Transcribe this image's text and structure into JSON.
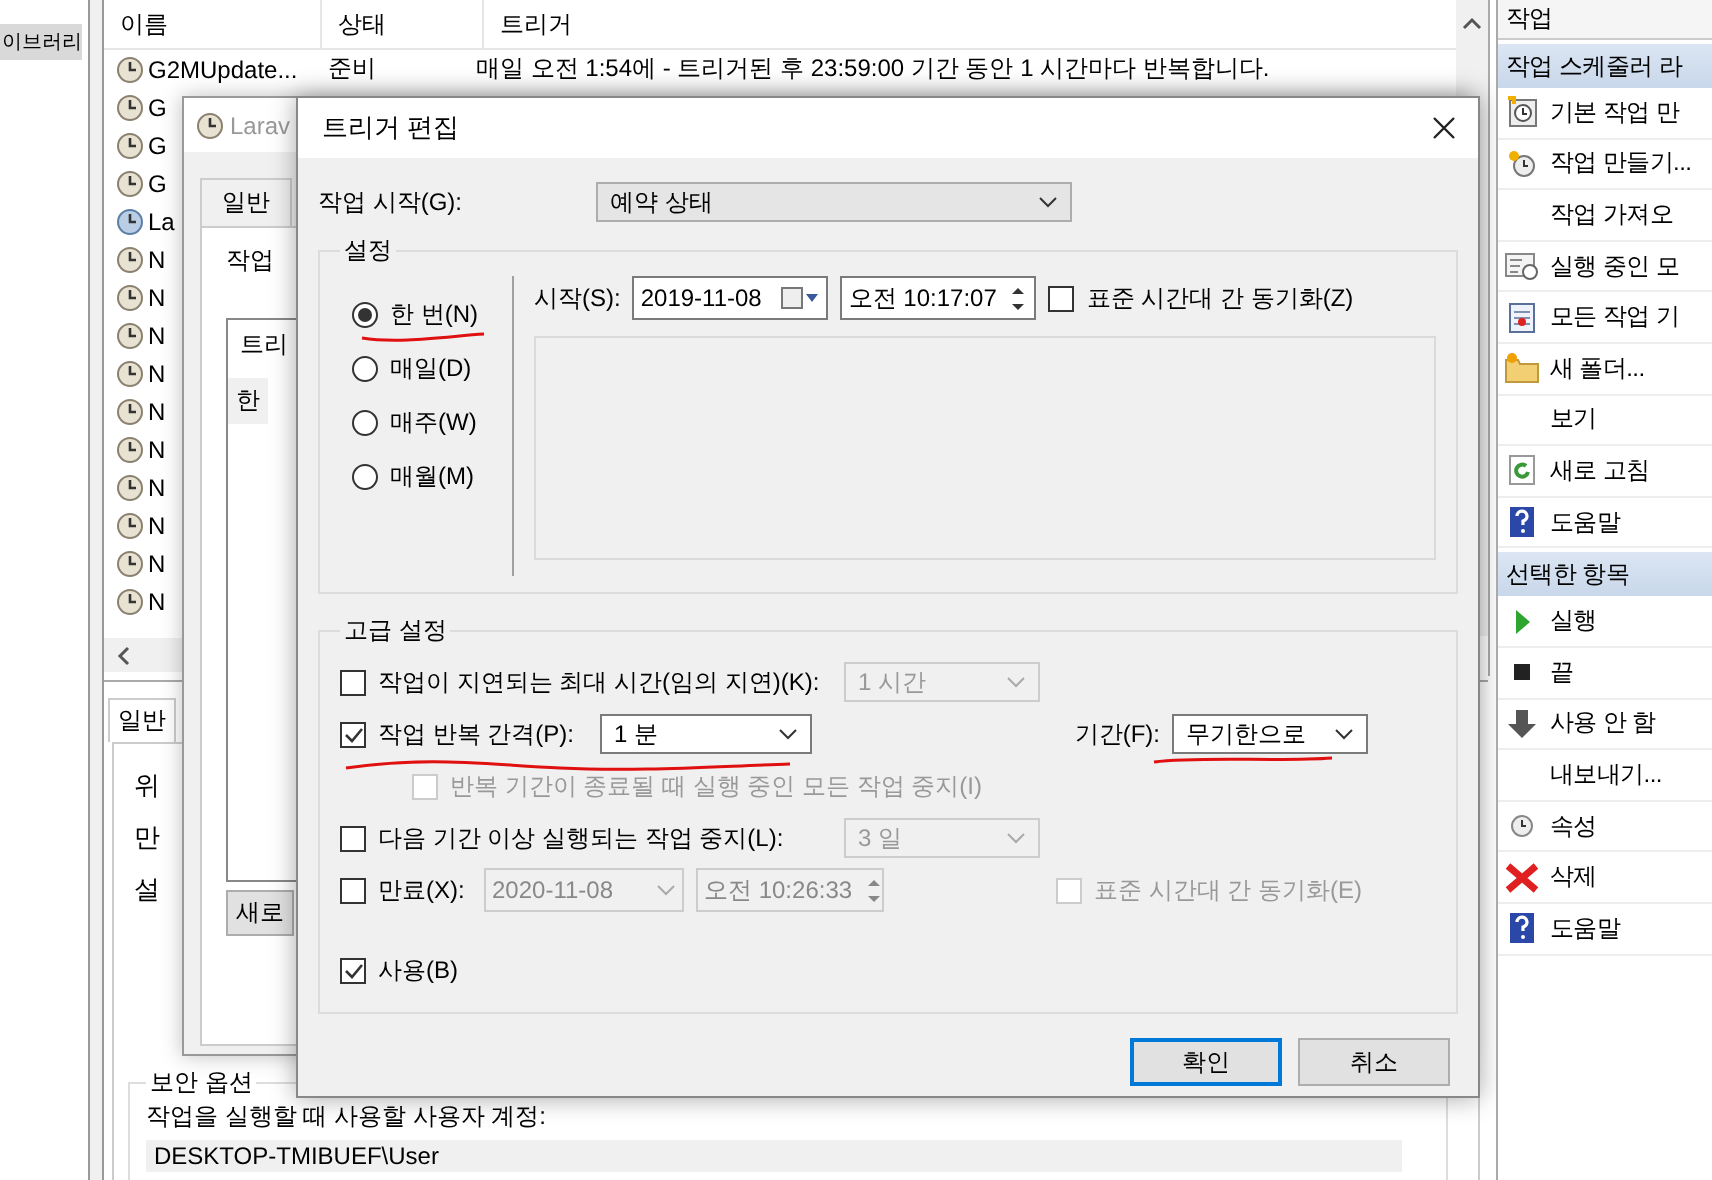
{
  "navigation": {
    "items": [
      {
        "label": "이브러리",
        "selected": true
      }
    ]
  },
  "task_list": {
    "columns": [
      "이름",
      "상태",
      "트리거"
    ],
    "rows": [
      {
        "name": "G2MUpdate...",
        "status": "준비",
        "trigger": "매일 오전 1:54에 - 트리거된 후 23:59:00 기간 동안 1 시간마다 반복합니다.",
        "selected": false
      },
      {
        "name": "G",
        "selected": false
      },
      {
        "name": "G",
        "selected": false
      },
      {
        "name": "G",
        "selected": false
      },
      {
        "name": "La",
        "selected": true
      },
      {
        "name": "N",
        "selected": false
      },
      {
        "name": "N",
        "selected": false
      },
      {
        "name": "N",
        "selected": false
      },
      {
        "name": "N",
        "selected": false
      },
      {
        "name": "N",
        "selected": false
      },
      {
        "name": "N",
        "selected": false
      },
      {
        "name": "N",
        "selected": false
      },
      {
        "name": "N",
        "selected": false
      },
      {
        "name": "N",
        "selected": false
      },
      {
        "name": "N",
        "selected": false
      }
    ]
  },
  "general_panel": {
    "tab": "일반",
    "labels": [
      "위",
      "만",
      "설"
    ],
    "security_group": "보안 옵션",
    "account_label": "작업을 실행할 때 사용할 사용자 계정:",
    "account": "DESKTOP-TMIBUEF\\User"
  },
  "task_window": {
    "title": "Larav",
    "tab": "일반",
    "prompt": "작업",
    "trigger_list": {
      "column": "트리",
      "rows": [
        "한"
      ]
    },
    "new_button": "새로"
  },
  "trigger_dialog": {
    "title": "트리거 편집",
    "begin_label": "작업 시작(G):",
    "begin_value": "예약 상태",
    "settings_group": "설정",
    "schedules": [
      {
        "label": "한 번(N)",
        "selected": true
      },
      {
        "label": "매일(D)",
        "selected": false
      },
      {
        "label": "매주(W)",
        "selected": false
      },
      {
        "label": "매월(M)",
        "selected": false
      }
    ],
    "start_label": "시작(S):",
    "start_date": "2019-11-08",
    "start_time": "오전 10:17:07",
    "sync_timezone": {
      "label": "표준 시간대 간 동기화(Z)",
      "checked": false
    },
    "advanced_group": "고급 설정",
    "delay": {
      "label": "작업이 지연되는 최대 시간(임의 지연)(K):",
      "checked": false,
      "value": "1 시간"
    },
    "repeat": {
      "label": "작업 반복 간격(P):",
      "checked": true,
      "value": "1 분",
      "duration_label": "기간(F):",
      "duration_value": "무기한으로"
    },
    "stop_at_end": {
      "label": "반복 기간이 종료될 때 실행 중인 모든 작업 중지(I)",
      "checked": false,
      "disabled": true
    },
    "stop_longer": {
      "label": "다음 기간 이상 실행되는 작업 중지(L):",
      "checked": false,
      "value": "3 일"
    },
    "expire": {
      "label": "만료(X):",
      "checked": false,
      "date": "2020-11-08",
      "time": "오전 10:26:33"
    },
    "expire_sync": {
      "label": "표준 시간대 간 동기화(E)",
      "checked": false,
      "disabled": true
    },
    "enabled": {
      "label": "사용(B)",
      "checked": true
    },
    "buttons": [
      {
        "label": "확인",
        "default": true
      },
      {
        "label": "취소",
        "default": false
      }
    ]
  },
  "actions_pane": {
    "title": "작업",
    "sections": [
      {
        "title": "작업 스케줄러 라",
        "items": [
          {
            "label": "기본 작업 만",
            "kind": "create-basic"
          },
          {
            "label": "작업 만들기...",
            "kind": "create"
          },
          {
            "label": "작업 가져오",
            "kind": "plain"
          },
          {
            "label": "실행 중인 모",
            "kind": "running"
          },
          {
            "label": "모든 작업 기",
            "kind": "history"
          },
          {
            "label": "새 폴더...",
            "kind": "folder"
          },
          {
            "label": "보기",
            "kind": "plain"
          },
          {
            "label": "새로 고침",
            "kind": "refresh"
          },
          {
            "label": "도움말",
            "kind": "help"
          }
        ]
      },
      {
        "title": "선택한 항목",
        "items": [
          {
            "label": "실행",
            "kind": "run"
          },
          {
            "label": "끝",
            "kind": "end"
          },
          {
            "label": "사용 안 함",
            "kind": "disable"
          },
          {
            "label": "내보내기...",
            "kind": "plain"
          },
          {
            "label": "속성",
            "kind": "properties"
          },
          {
            "label": "삭제",
            "kind": "delete"
          },
          {
            "label": "도움말",
            "kind": "help"
          }
        ]
      }
    ]
  }
}
